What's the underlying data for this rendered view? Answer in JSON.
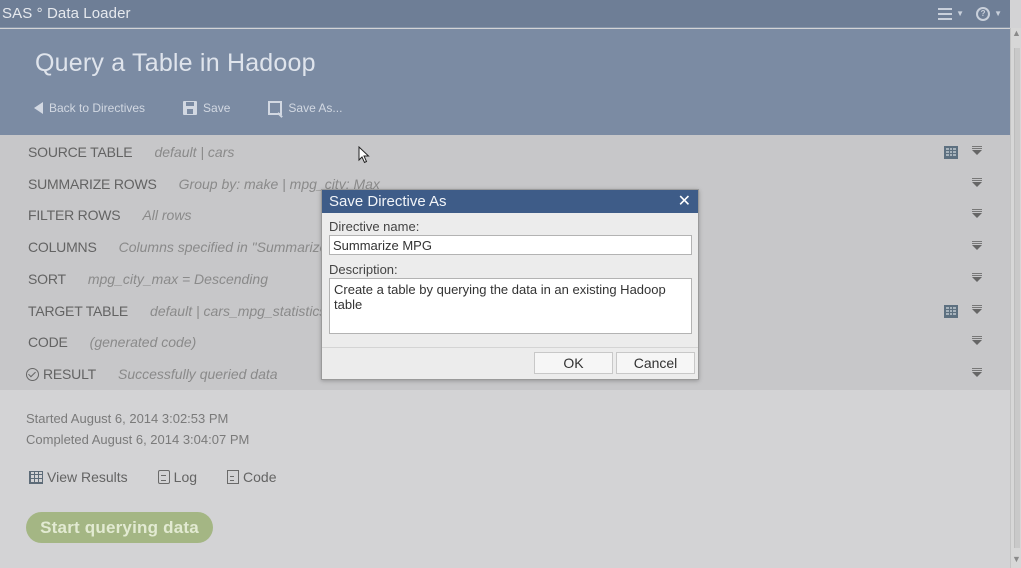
{
  "app": {
    "title": "SAS ° Data Loader",
    "menu_icon": "list-menu-icon",
    "help_icon": "help-icon"
  },
  "header": {
    "title": "Query a Table in Hadoop",
    "toolbar": {
      "back_label": "Back to Directives",
      "save_label": "Save",
      "save_as_label": "Save As..."
    }
  },
  "rows": [
    {
      "label": "SOURCE TABLE",
      "value": "default  |  cars",
      "has_table_icon": true
    },
    {
      "label": "SUMMARIZE ROWS",
      "value": "Group by: make | mpg_city: Max",
      "has_table_icon": false
    },
    {
      "label": "FILTER ROWS",
      "value": "All rows",
      "has_table_icon": false
    },
    {
      "label": "COLUMNS",
      "value": "Columns specified in \"Summarize Rows\"",
      "has_table_icon": false
    },
    {
      "label": "SORT",
      "value": "mpg_city_max = Descending",
      "has_table_icon": false
    },
    {
      "label": "TARGET TABLE",
      "value": "default  |  cars_mpg_statistics",
      "has_table_icon": true
    },
    {
      "label": "CODE",
      "value": "(generated code)",
      "has_table_icon": false
    },
    {
      "label": "RESULT",
      "value": "Successfully queried data",
      "has_table_icon": false,
      "status_icon": "check-circle-icon"
    }
  ],
  "result": {
    "started": "Started August 6, 2014 3:02:53 PM",
    "completed": "Completed August 6, 2014 3:04:07 PM",
    "links": {
      "view_results": "View Results",
      "log": "Log",
      "code": "Code"
    },
    "start_button": "Start querying data"
  },
  "dialog": {
    "title": "Save Directive As",
    "name_label": "Directive name:",
    "name_value": "Summarize MPG",
    "description_label": "Description:",
    "description_value": "Create a table by querying the data in an existing Hadoop table",
    "ok_label": "OK",
    "cancel_label": "Cancel"
  },
  "colors": {
    "appbar": "#6e7e96",
    "header": "#7b8ba3",
    "dialog_header": "#3e5c88",
    "start_button": "#a4b684"
  }
}
